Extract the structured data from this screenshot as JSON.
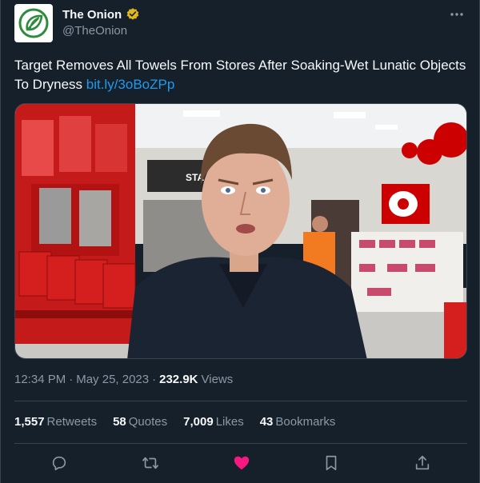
{
  "author": {
    "name": "The Onion",
    "handle": "@TheOnion",
    "verified_color": "#e2b719"
  },
  "tweet": {
    "text": "Target Removes All Towels From Stores After Soaking-Wet Lunatic Objects To Dryness ",
    "link": "bit.ly/3oBoZPp"
  },
  "meta": {
    "time": "12:34 PM",
    "sep1": "·",
    "date": "May 25, 2023",
    "sep2": "·",
    "views": "232.9K",
    "views_label": "Views"
  },
  "stats": [
    {
      "value": "1,557",
      "label": "Retweets"
    },
    {
      "value": "58",
      "label": "Quotes"
    },
    {
      "value": "7,009",
      "label": "Likes"
    },
    {
      "value": "43",
      "label": "Bookmarks"
    }
  ],
  "actions": [
    {
      "icon": "reply-icon"
    },
    {
      "icon": "retweet-icon"
    },
    {
      "icon": "like-icon",
      "active": true,
      "color": "#f91880"
    },
    {
      "icon": "bookmark-icon"
    },
    {
      "icon": "share-icon"
    }
  ],
  "media": {
    "sign_text": "STA"
  },
  "colors": {
    "background": "#15202b",
    "text": "#f7f9f9",
    "secondary": "#8b98a5",
    "link": "#1d9bf0",
    "border": "#38444d",
    "target_red": "#cc0000"
  }
}
